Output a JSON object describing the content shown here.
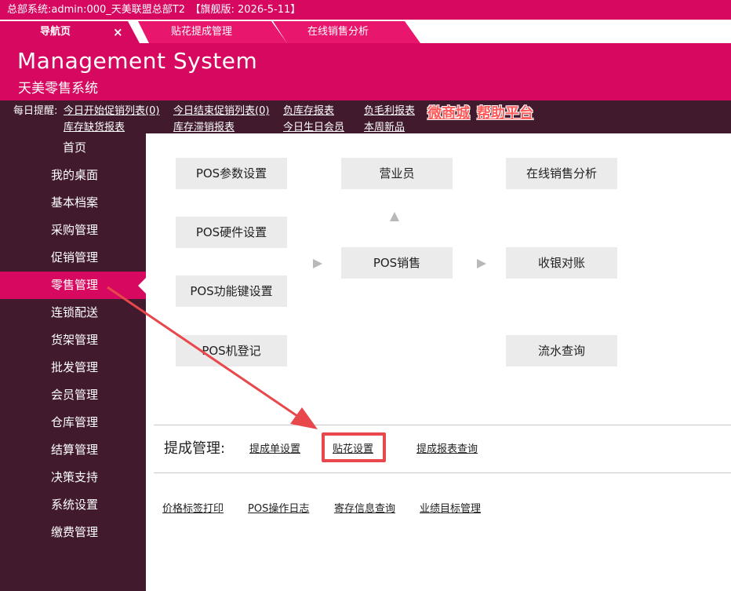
{
  "window": {
    "title": "总部系统:admin:000_天美联盟总部T2　【旗舰版: 2026-5-11】"
  },
  "tabs": [
    {
      "label": "导航页",
      "close": "×"
    },
    {
      "label": "贴花提成管理"
    },
    {
      "label": "在线销售分析"
    }
  ],
  "header": {
    "brand_en": "Management System",
    "brand_cn": "天美零售系统"
  },
  "reminders": {
    "label": "每日提醒:",
    "links": [
      "今日开始促销列表(0)",
      "今日结束促销列表(0)",
      "负库存报表",
      "负毛利报表",
      "库存缺货报表",
      "库存滞销报表",
      "今日生日会员",
      "本周新品"
    ],
    "weishop": "微商城",
    "help": "帮助平台"
  },
  "sidebar": {
    "items": [
      "首页",
      "我的桌面",
      "基本档案",
      "采购管理",
      "促销管理",
      "零售管理",
      "连锁配送",
      "货架管理",
      "批发管理",
      "会员管理",
      "仓库管理",
      "结算管理",
      "决策支持",
      "系统设置",
      "缴费管理"
    ],
    "active": "零售管理"
  },
  "flow": {
    "pos_params": "POS参数设置",
    "pos_hardware": "POS硬件设置",
    "pos_function_keys": "POS功能键设置",
    "pos_register": "POS机登记",
    "cashier": "营业员",
    "pos_sales": "POS销售",
    "online_sales": "在线销售分析",
    "cash_reconcile": "收银对账",
    "journal_query": "流水查询"
  },
  "commission": {
    "label": "提成管理:",
    "links": [
      "提成单设置",
      "贴花设置",
      "提成报表查询"
    ]
  },
  "other_links": [
    "价格标签打印",
    "POS操作日志",
    "寄存信息查询",
    "业绩目标管理"
  ],
  "colors": {
    "brand": "#d6085f",
    "dark": "#411a2d",
    "annotation": "#e8474b"
  }
}
